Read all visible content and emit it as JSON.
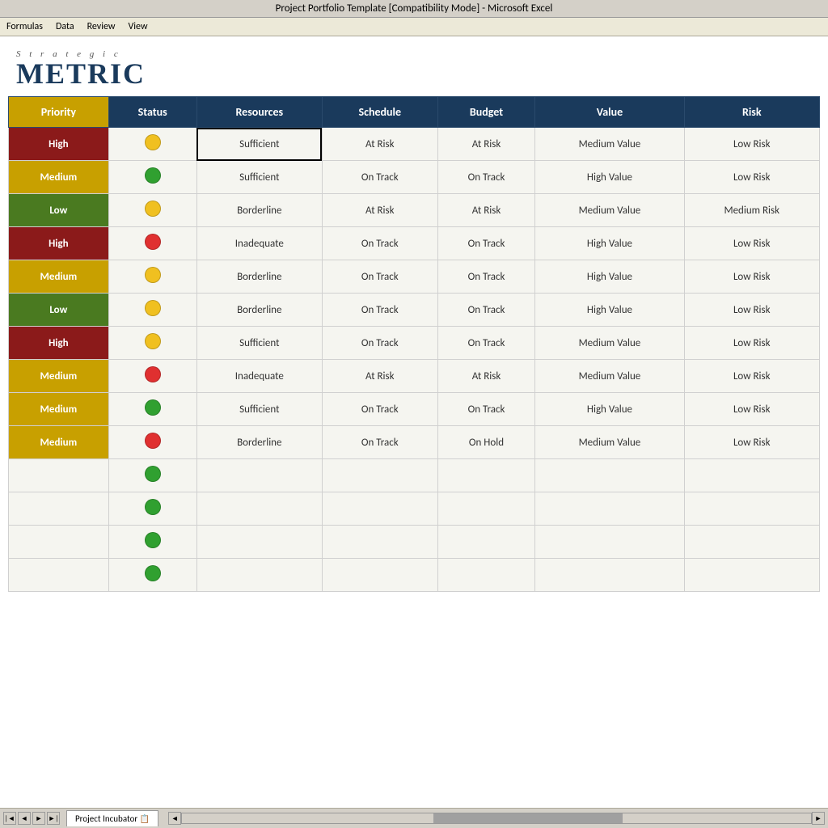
{
  "titleBar": {
    "text": "Project Portfolio Template [Compatibility Mode]  -  Microsoft Excel"
  },
  "menuBar": {
    "items": [
      "Formulas",
      "Data",
      "Review",
      "View"
    ]
  },
  "logo": {
    "strategic": "S t r a t e g i c",
    "metric": "METRIC"
  },
  "table": {
    "headers": [
      "Priority",
      "Status",
      "Resources",
      "Schedule",
      "Budget",
      "Value",
      "Risk"
    ],
    "rows": [
      {
        "priority": "High",
        "priorityClass": "priority-high",
        "status": "yellow",
        "resources": "Sufficient",
        "schedule": "At Risk",
        "budget": "At Risk",
        "value": "Medium Value",
        "risk": "Low Risk",
        "resourcesSelected": true
      },
      {
        "priority": "Medium",
        "priorityClass": "priority-medium",
        "status": "green",
        "resources": "Sufficient",
        "schedule": "On Track",
        "budget": "On Track",
        "value": "High Value",
        "risk": "Low Risk",
        "resourcesSelected": false
      },
      {
        "priority": "Low",
        "priorityClass": "priority-low",
        "status": "yellow",
        "resources": "Borderline",
        "schedule": "At Risk",
        "budget": "At Risk",
        "value": "Medium Value",
        "risk": "Medium Risk",
        "resourcesSelected": false
      },
      {
        "priority": "High",
        "priorityClass": "priority-high",
        "status": "red",
        "resources": "Inadequate",
        "schedule": "On Track",
        "budget": "On Track",
        "value": "High Value",
        "risk": "Low Risk",
        "resourcesSelected": false
      },
      {
        "priority": "Medium",
        "priorityClass": "priority-medium",
        "status": "yellow",
        "resources": "Borderline",
        "schedule": "On Track",
        "budget": "On Track",
        "value": "High Value",
        "risk": "Low Risk",
        "resourcesSelected": false
      },
      {
        "priority": "Low",
        "priorityClass": "priority-low",
        "status": "yellow",
        "resources": "Borderline",
        "schedule": "On Track",
        "budget": "On Track",
        "value": "High Value",
        "risk": "Low Risk",
        "resourcesSelected": false
      },
      {
        "priority": "High",
        "priorityClass": "priority-high",
        "status": "yellow",
        "resources": "Sufficient",
        "schedule": "On Track",
        "budget": "On Track",
        "value": "Medium Value",
        "risk": "Low Risk",
        "resourcesSelected": false
      },
      {
        "priority": "Medium",
        "priorityClass": "priority-medium",
        "status": "red",
        "resources": "Inadequate",
        "schedule": "At Risk",
        "budget": "At Risk",
        "value": "Medium Value",
        "risk": "Low Risk",
        "resourcesSelected": false
      },
      {
        "priority": "Medium",
        "priorityClass": "priority-medium",
        "status": "green",
        "resources": "Sufficient",
        "schedule": "On Track",
        "budget": "On Track",
        "value": "High Value",
        "risk": "Low Risk",
        "resourcesSelected": false
      },
      {
        "priority": "Medium",
        "priorityClass": "priority-medium",
        "status": "red",
        "resources": "Borderline",
        "schedule": "On Track",
        "budget": "On Hold",
        "value": "Medium Value",
        "risk": "Low Risk",
        "resourcesSelected": false
      }
    ],
    "emptyRows": [
      {
        "status": "green"
      },
      {
        "status": "green"
      },
      {
        "status": "green"
      },
      {
        "status": "green"
      }
    ]
  },
  "tabBar": {
    "sheetName": "Project Incubator",
    "sheetIcon": "📋"
  },
  "colors": {
    "priorityHigh": "#8b1a1a",
    "priorityMedium": "#c8a000",
    "priorityLow": "#4a7a20",
    "headerDark": "#1a3a5c",
    "dotYellow": "#f0c020",
    "dotGreen": "#30a030",
    "dotRed": "#e03030"
  }
}
